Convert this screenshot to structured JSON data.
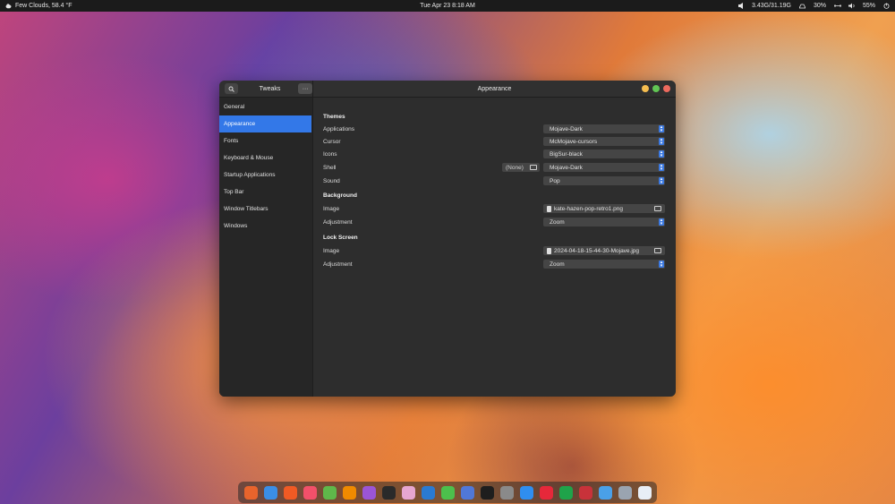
{
  "topbar": {
    "weather": "Few Clouds, 58.4 °F",
    "datetime": "Tue Apr 23   8:18 AM",
    "memory": "3.43G/31.19G",
    "cpu": "30%",
    "battery": "55%"
  },
  "window": {
    "app_name": "Tweaks",
    "title": "Appearance",
    "menu_label": "···"
  },
  "sidebar": {
    "items": [
      {
        "label": "General"
      },
      {
        "label": "Appearance"
      },
      {
        "label": "Fonts"
      },
      {
        "label": "Keyboard & Mouse"
      },
      {
        "label": "Startup Applications"
      },
      {
        "label": "Top Bar"
      },
      {
        "label": "Window Titlebars"
      },
      {
        "label": "Windows"
      }
    ],
    "active_index": 1
  },
  "themes": {
    "title": "Themes",
    "applications": {
      "label": "Applications",
      "value": "Mojave-Dark"
    },
    "cursor": {
      "label": "Cursor",
      "value": "McMojave-cursors"
    },
    "icons": {
      "label": "Icons",
      "value": "BigSur-black"
    },
    "shell": {
      "label": "Shell",
      "none_label": "(None)",
      "value": "Mojave-Dark"
    },
    "sound": {
      "label": "Sound",
      "value": "Pop"
    }
  },
  "background": {
    "title": "Background",
    "image": {
      "label": "Image",
      "value": "kate-hazen-pop-retro1.png"
    },
    "adjustment": {
      "label": "Adjustment",
      "value": "Zoom"
    }
  },
  "lockscreen": {
    "title": "Lock Screen",
    "image": {
      "label": "Image",
      "value": "2024-04-18-15-44-30-Mojave.jpg"
    },
    "adjustment": {
      "label": "Adjustment",
      "value": "Zoom"
    }
  },
  "dock": {
    "apps": [
      {
        "icon": "firefox-icon",
        "color": "#e8642c"
      },
      {
        "icon": "mail-icon",
        "color": "#3a8ee6"
      },
      {
        "icon": "brave-icon",
        "color": "#f05a24"
      },
      {
        "icon": "music-icon",
        "color": "#f2506a"
      },
      {
        "icon": "maps-icon",
        "color": "#5fb84a"
      },
      {
        "icon": "vlc-icon",
        "color": "#f08a00"
      },
      {
        "icon": "podcasts-icon",
        "color": "#9b55d6"
      },
      {
        "icon": "headphones-icon",
        "color": "#2a2a2a"
      },
      {
        "icon": "paint-icon",
        "color": "#e6a6d0"
      },
      {
        "icon": "image-viewer-icon",
        "color": "#2a7ad2"
      },
      {
        "icon": "pen-icon",
        "color": "#4cc04c"
      },
      {
        "icon": "document-viewer-icon",
        "color": "#5078d8"
      },
      {
        "icon": "terminal-icon",
        "color": "#1e1e1e"
      },
      {
        "icon": "chrome-icon",
        "color": "#8a8a8a"
      },
      {
        "icon": "app-store-icon",
        "color": "#2f8ef0"
      },
      {
        "icon": "opera-icon",
        "color": "#e6283a"
      },
      {
        "icon": "security-icon",
        "color": "#1fa34a"
      },
      {
        "icon": "pdf-icon",
        "color": "#c8323a"
      },
      {
        "icon": "files-icon",
        "color": "#4aa0e8"
      },
      {
        "icon": "launcher-icon",
        "color": "#9aa4b0"
      },
      {
        "icon": "settings-icon",
        "color": "#e8eef6"
      }
    ]
  }
}
